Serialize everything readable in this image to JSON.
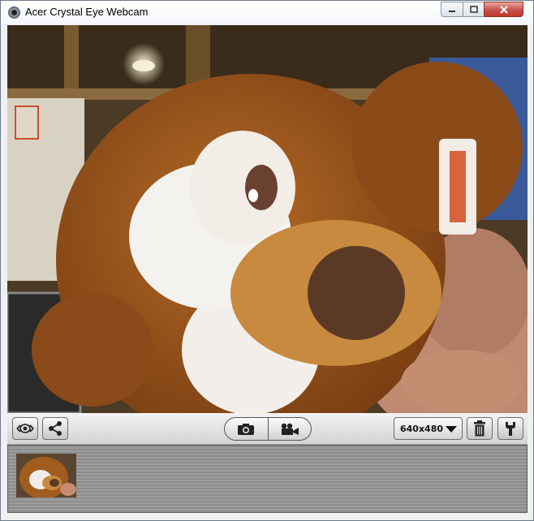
{
  "window": {
    "title": "Acer Crystal Eye Webcam"
  },
  "titlebar_buttons": {
    "minimize_icon": "minimize-icon",
    "maximize_icon": "maximize-icon",
    "close_icon": "close-icon"
  },
  "toolbar": {
    "preview_icon": "eye-icon",
    "share_icon": "share-icon",
    "photo_icon": "camera-icon",
    "video_icon": "video-camera-icon",
    "resolution": "640x480",
    "delete_icon": "trash-icon",
    "settings_icon": "wrench-icon"
  },
  "gallery": {
    "items": [
      {
        "type": "photo-thumbnail"
      }
    ]
  },
  "colors": {
    "close_button": "#c75050",
    "toolbar": "#e3e3e3",
    "strip": "#9a9a9a"
  }
}
